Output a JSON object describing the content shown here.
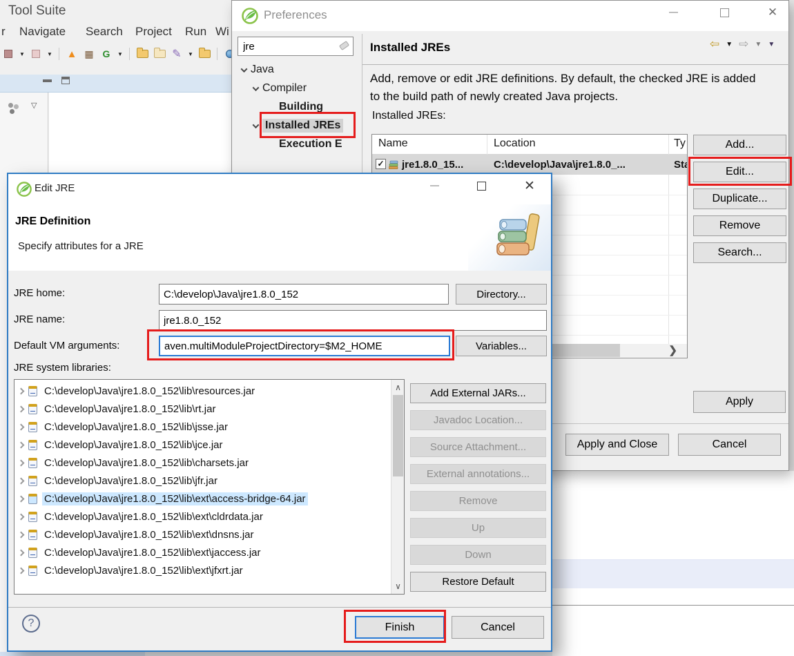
{
  "colors": {
    "annotation": "#e51c1c",
    "focus_blue": "#2a7ad4",
    "selection_blue": "#cde8ff",
    "spring_green": "#68bd45"
  },
  "background": {
    "window_title": "Tool Suite",
    "menu": [
      "r",
      "Navigate",
      "Search",
      "Project",
      "Run",
      "Wi"
    ],
    "toolbar_icons": [
      "stop-icon",
      "dropdown-icon",
      "step-icon",
      "dropdown-icon",
      "boot-flame-icon",
      "grid-icon",
      "update-icon",
      "dropdown-icon",
      "open-folder-icon",
      "folder-icon",
      "brush-icon",
      "dropdown-icon",
      "folder-icon",
      "globe-icon"
    ],
    "panel_icons": [
      "minimize-view-icon",
      "maximize-view-icon",
      "package-explorer-icon",
      "view-menu-icon"
    ]
  },
  "preferences": {
    "title": "Preferences",
    "search_value": "jre",
    "tree": {
      "java": "Java",
      "compiler": "Compiler",
      "building": "Building",
      "installed_jres": "Installed JREs",
      "execution": "Execution E"
    },
    "content": {
      "header": "Installed JREs",
      "description": "Add, remove or edit JRE definitions. By default, the checked JRE is added to the build path of newly created Java projects.",
      "list_label": "Installed JREs:",
      "table": {
        "columns": [
          "Name",
          "Location",
          "Ty"
        ],
        "row": {
          "checked": "✓",
          "name": "jre1.8.0_15...",
          "location": "C:\\develop\\Java\\jre1.8.0_...",
          "type": "Sta"
        }
      },
      "buttons": {
        "add": "Add...",
        "edit": "Edit...",
        "duplicate": "Duplicate...",
        "remove": "Remove",
        "search": "Search..."
      },
      "apply": "Apply"
    },
    "footer": {
      "apply_and_close": "Apply and Close",
      "cancel": "Cancel"
    }
  },
  "edit_jre": {
    "title": "Edit JRE",
    "heading": "JRE Definition",
    "subheading": "Specify attributes for a JRE",
    "jre_home_label": "JRE home:",
    "jre_home_value": "C:\\develop\\Java\\jre1.8.0_152",
    "directory_button": "Directory...",
    "jre_name_label": "JRE name:",
    "jre_name_value": "jre1.8.0_152",
    "vm_args_label": "Default VM arguments:",
    "vm_args_value": "aven.multiModuleProjectDirectory=$M2_HOME",
    "variables_button": "Variables...",
    "libraries_label": "JRE system libraries:",
    "libraries": [
      {
        "path": "C:\\develop\\Java\\jre1.8.0_152\\lib\\resources.jar"
      },
      {
        "path": "C:\\develop\\Java\\jre1.8.0_152\\lib\\rt.jar"
      },
      {
        "path": "C:\\develop\\Java\\jre1.8.0_152\\lib\\jsse.jar"
      },
      {
        "path": "C:\\develop\\Java\\jre1.8.0_152\\lib\\jce.jar"
      },
      {
        "path": "C:\\develop\\Java\\jre1.8.0_152\\lib\\charsets.jar"
      },
      {
        "path": "C:\\develop\\Java\\jre1.8.0_152\\lib\\jfr.jar"
      },
      {
        "path": "C:\\develop\\Java\\jre1.8.0_152\\lib\\ext\\access-bridge-64.jar",
        "selected": true
      },
      {
        "path": "C:\\develop\\Java\\jre1.8.0_152\\lib\\ext\\cldrdata.jar"
      },
      {
        "path": "C:\\develop\\Java\\jre1.8.0_152\\lib\\ext\\dnsns.jar"
      },
      {
        "path": "C:\\develop\\Java\\jre1.8.0_152\\lib\\ext\\jaccess.jar"
      },
      {
        "path": "C:\\develop\\Java\\jre1.8.0_152\\lib\\ext\\jfxrt.jar"
      }
    ],
    "lib_buttons": {
      "add_external": "Add External JARs...",
      "javadoc": "Javadoc Location...",
      "source": "Source Attachment...",
      "annotations": "External annotations...",
      "remove": "Remove",
      "up": "Up",
      "down": "Down",
      "restore": "Restore Default"
    },
    "finish": "Finish",
    "cancel": "Cancel"
  }
}
